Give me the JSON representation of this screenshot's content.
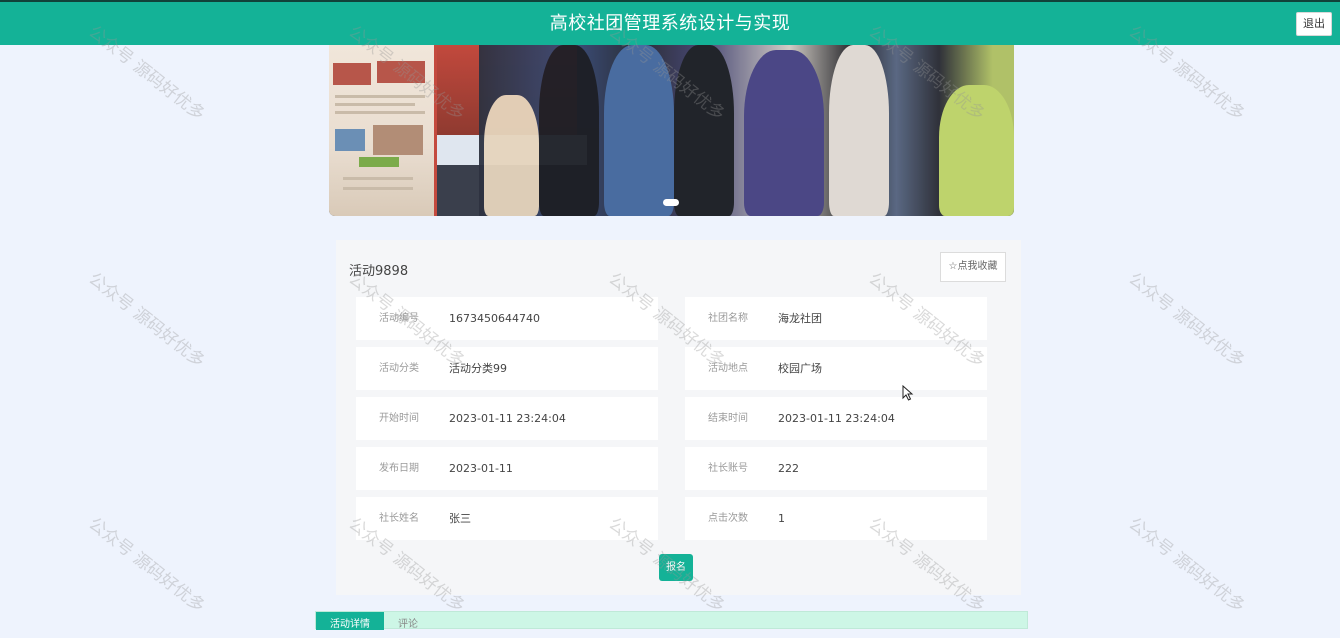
{
  "header": {
    "title": "高校社团管理系统设计与实现",
    "logout_label": "退出"
  },
  "activity": {
    "title": "活动9898",
    "collect_label": "☆点我收藏",
    "signup_label": "报名",
    "fields_left": [
      {
        "label": "活动编号",
        "value": "1673450644740"
      },
      {
        "label": "活动分类",
        "value": "活动分类99"
      },
      {
        "label": "开始时间",
        "value": "2023-01-11 23:24:04"
      },
      {
        "label": "发布日期",
        "value": "2023-01-11"
      },
      {
        "label": "社长姓名",
        "value": "张三"
      }
    ],
    "fields_right": [
      {
        "label": "社团名称",
        "value": "海龙社团"
      },
      {
        "label": "活动地点",
        "value": "校园广场"
      },
      {
        "label": "结束时间",
        "value": "2023-01-11 23:24:04"
      },
      {
        "label": "社长账号",
        "value": "222"
      },
      {
        "label": "点击次数",
        "value": "1"
      }
    ]
  },
  "tabs": [
    {
      "label": "活动详情"
    },
    {
      "label": "评论"
    }
  ],
  "watermark": {
    "text": "公众号 源码好优多"
  },
  "colors": {
    "primary": "#14b297",
    "background": "#eef3fd",
    "panel": "#f5f6f8"
  }
}
